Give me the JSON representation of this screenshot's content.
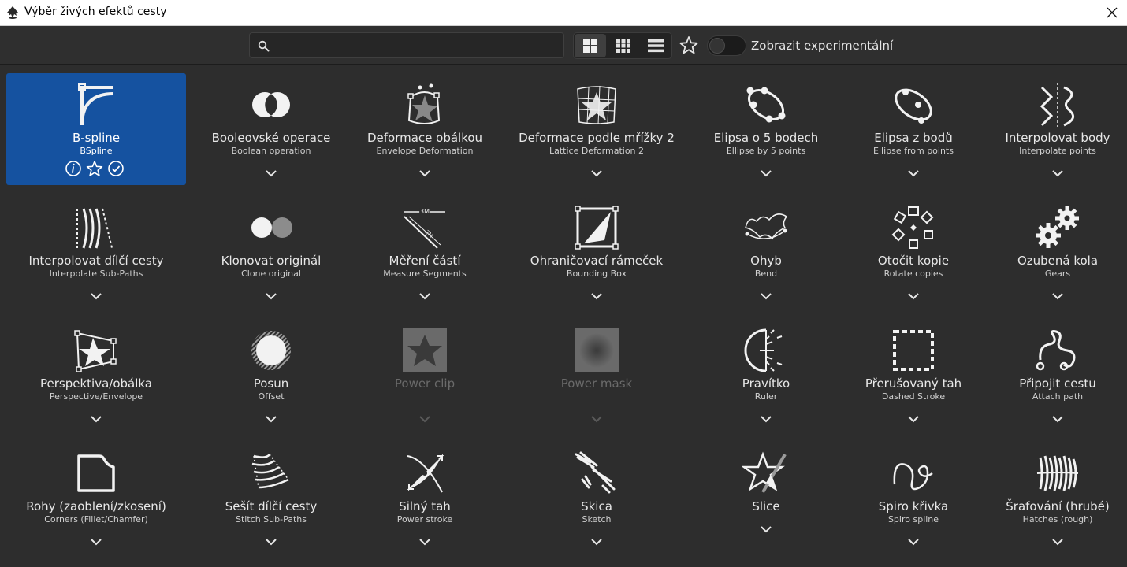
{
  "window": {
    "title": "Výběr živých efektů cesty",
    "app_icon": "inkscape-logo-icon",
    "close_icon": "close-icon"
  },
  "toolbar": {
    "search": {
      "value": "",
      "placeholder": "",
      "icon": "search-icon"
    },
    "view_modes": [
      {
        "name": "large-grid",
        "icon": "large-grid-icon",
        "active": true
      },
      {
        "name": "small-grid",
        "icon": "small-grid-icon",
        "active": false
      },
      {
        "name": "list",
        "icon": "list-icon",
        "active": false
      }
    ],
    "favorites_icon": "star-icon",
    "experimental_toggle": {
      "on": false,
      "label": "Zobrazit experimentální"
    }
  },
  "effects": [
    {
      "name": "B-spline",
      "sub": "BSpline",
      "icon": "bspline-icon",
      "selected": true,
      "disabled": false,
      "actions": [
        "info-icon",
        "star-icon",
        "check-icon"
      ]
    },
    {
      "name": "Booleovské operace",
      "sub": "Boolean operation",
      "icon": "boolean-icon",
      "selected": false,
      "disabled": false
    },
    {
      "name": "Deformace obálkou",
      "sub": "Envelope Deformation",
      "icon": "envelope-deformation-icon",
      "selected": false,
      "disabled": false
    },
    {
      "name": "Deformace podle mřížky 2",
      "sub": "Lattice Deformation 2",
      "icon": "lattice-icon",
      "selected": false,
      "disabled": false
    },
    {
      "name": "Elipsa o 5 bodech",
      "sub": "Ellipse by 5 points",
      "icon": "ellipse-5-points-icon",
      "selected": false,
      "disabled": false
    },
    {
      "name": "Elipsa z bodů",
      "sub": "Ellipse from points",
      "icon": "ellipse-from-points-icon",
      "selected": false,
      "disabled": false
    },
    {
      "name": "Interpolovat body",
      "sub": "Interpolate points",
      "icon": "interpolate-points-icon",
      "selected": false,
      "disabled": false
    },
    {
      "name": "Interpolovat dílčí cesty",
      "sub": "Interpolate Sub-Paths",
      "icon": "interpolate-subpaths-icon",
      "selected": false,
      "disabled": false
    },
    {
      "name": "Klonovat originál",
      "sub": "Clone original",
      "icon": "clone-original-icon",
      "selected": false,
      "disabled": false
    },
    {
      "name": "Měření částí",
      "sub": "Measure Segments",
      "icon": "measure-segments-icon",
      "selected": false,
      "disabled": false,
      "icon_text": [
        "3M",
        "2M"
      ]
    },
    {
      "name": "Ohraničovací rámeček",
      "sub": "Bounding Box",
      "icon": "bounding-box-icon",
      "selected": false,
      "disabled": false
    },
    {
      "name": "Ohyb",
      "sub": "Bend",
      "icon": "bend-icon",
      "selected": false,
      "disabled": false
    },
    {
      "name": "Otočit kopie",
      "sub": "Rotate copies",
      "icon": "rotate-copies-icon",
      "selected": false,
      "disabled": false
    },
    {
      "name": "Ozubená kola",
      "sub": "Gears",
      "icon": "gears-icon",
      "selected": false,
      "disabled": false
    },
    {
      "name": "Perspektiva/obálka",
      "sub": "Perspective/Envelope",
      "icon": "perspective-envelope-icon",
      "selected": false,
      "disabled": false
    },
    {
      "name": "Posun",
      "sub": "Offset",
      "icon": "offset-icon",
      "selected": false,
      "disabled": false
    },
    {
      "name": "Power clip",
      "sub": "",
      "icon": "power-clip-icon",
      "selected": false,
      "disabled": true
    },
    {
      "name": "Power mask",
      "sub": "",
      "icon": "power-mask-icon",
      "selected": false,
      "disabled": true
    },
    {
      "name": "Pravítko",
      "sub": "Ruler",
      "icon": "ruler-icon",
      "selected": false,
      "disabled": false
    },
    {
      "name": "Přerušovaný tah",
      "sub": "Dashed Stroke",
      "icon": "dashed-stroke-icon",
      "selected": false,
      "disabled": false
    },
    {
      "name": "Připojit cestu",
      "sub": "Attach path",
      "icon": "attach-path-icon",
      "selected": false,
      "disabled": false
    },
    {
      "name": "Rohy (zaoblení/zkosení)",
      "sub": "Corners (Fillet/Chamfer)",
      "icon": "corners-icon",
      "selected": false,
      "disabled": false
    },
    {
      "name": "Sešít dílčí cesty",
      "sub": "Stitch Sub-Paths",
      "icon": "stitch-subpaths-icon",
      "selected": false,
      "disabled": false
    },
    {
      "name": "Silný tah",
      "sub": "Power stroke",
      "icon": "power-stroke-icon",
      "selected": false,
      "disabled": false
    },
    {
      "name": "Skica",
      "sub": "Sketch",
      "icon": "sketch-icon",
      "selected": false,
      "disabled": false
    },
    {
      "name": "Slice",
      "sub": "",
      "icon": "slice-icon",
      "selected": false,
      "disabled": false
    },
    {
      "name": "Spiro křivka",
      "sub": "Spiro spline",
      "icon": "spiro-spline-icon",
      "selected": false,
      "disabled": false
    },
    {
      "name": "Šrafování (hrubé)",
      "sub": "Hatches (rough)",
      "icon": "hatches-rough-icon",
      "selected": false,
      "disabled": false
    }
  ],
  "colors": {
    "background": "#2d2d2d",
    "selected_tile": "#1552a0",
    "text": "#e8e8e8",
    "disabled_text": "#6a6a6a",
    "titlebar": "#ffffff"
  }
}
